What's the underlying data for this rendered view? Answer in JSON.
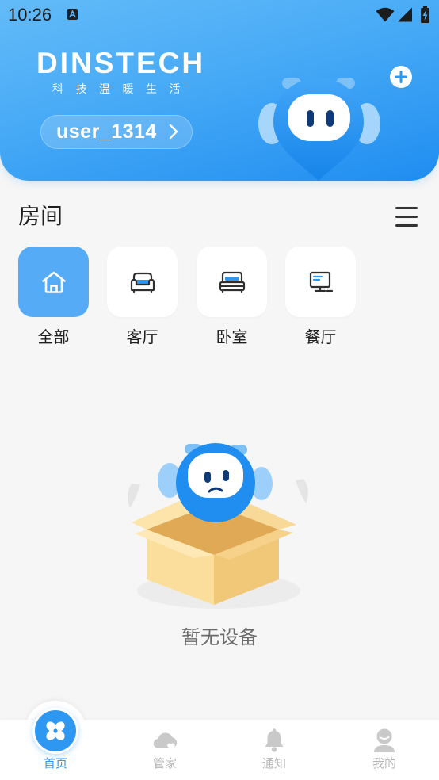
{
  "status_bar": {
    "time": "10:26",
    "notification_icon": "font-notification-icon",
    "wifi_icon": "wifi-icon",
    "signal_icon": "cellular-signal-icon",
    "battery_icon": "battery-charging-icon"
  },
  "header": {
    "brand": "DINSTECH",
    "slogan": "科技温暖生活",
    "user_name": "user_1314",
    "user_chevron_icon": "chevron-right-icon",
    "add_icon": "plus-icon",
    "mascot_icon": "mascot-illustration"
  },
  "rooms": {
    "title": "房间",
    "menu_icon": "menu-icon",
    "items": [
      {
        "label": "全部",
        "icon": "home-icon",
        "selected": true
      },
      {
        "label": "客厅",
        "icon": "sofa-icon",
        "selected": false
      },
      {
        "label": "卧室",
        "icon": "bed-icon",
        "selected": false
      },
      {
        "label": "餐厅",
        "icon": "desk-icon",
        "selected": false
      }
    ]
  },
  "empty_state": {
    "illustration_icon": "empty-box-mascot-illustration",
    "message": "暂无设备"
  },
  "tab_bar": {
    "tabs": [
      {
        "label": "首页",
        "icon": "home-flower-icon",
        "active": true
      },
      {
        "label": "管家",
        "icon": "cloud-heart-icon",
        "active": false
      },
      {
        "label": "通知",
        "icon": "bell-icon",
        "active": false
      },
      {
        "label": "我的",
        "icon": "profile-icon",
        "active": false
      }
    ]
  },
  "colors": {
    "primary": "#2d97f2",
    "header_gradient_start": "#63bbf8",
    "header_gradient_end": "#1f8df0",
    "tile_selected": "#55abf6",
    "page_background": "#f6f6f6",
    "text_primary": "#1e1e1e",
    "text_muted": "#6a6a6a",
    "tab_inactive": "#b5b5b5"
  }
}
